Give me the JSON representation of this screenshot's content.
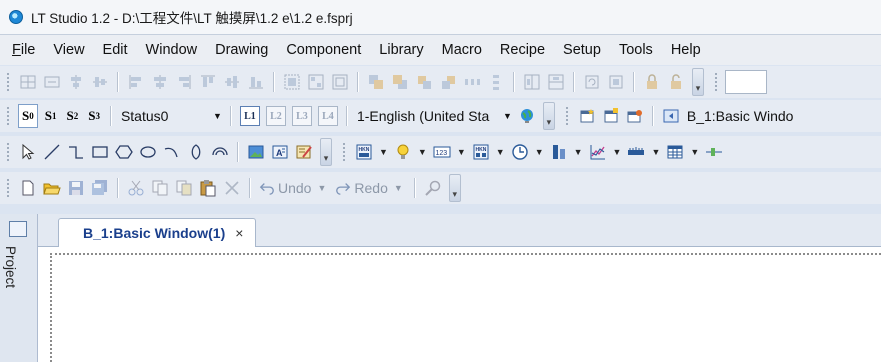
{
  "window": {
    "title": "LT Studio 1.2 - D:\\工程文件\\LT 触摸屏\\1.2 e\\1.2 e.fsprj"
  },
  "menu": [
    {
      "label": "File"
    },
    {
      "label": "View"
    },
    {
      "label": "Edit"
    },
    {
      "label": "Window"
    },
    {
      "label": "Drawing"
    },
    {
      "label": "Component"
    },
    {
      "label": "Library"
    },
    {
      "label": "Macro"
    },
    {
      "label": "Recipe"
    },
    {
      "label": "Setup"
    },
    {
      "label": "Tools"
    },
    {
      "label": "Help"
    }
  ],
  "toolbar2": {
    "status_buttons": [
      "S",
      "S",
      "S",
      "S"
    ],
    "status_subs": [
      "0",
      "1",
      "2",
      "3"
    ],
    "status_combo": "Status0",
    "layer_buttons": [
      "L1",
      "L2",
      "L3",
      "L4"
    ],
    "language_combo": "1-English (United Sta",
    "window_selector": "B_1:Basic Windo"
  },
  "toolbar4": {
    "undo": "Undo",
    "redo": "Redo"
  },
  "sidepanel": {
    "label": "Project"
  },
  "tabs": [
    {
      "label": "B_1:Basic Window(1)",
      "close": "×"
    }
  ]
}
